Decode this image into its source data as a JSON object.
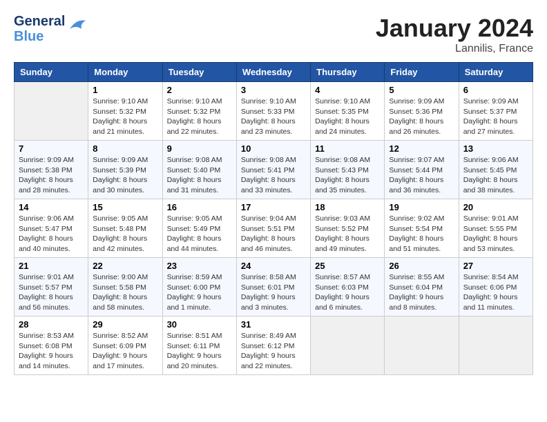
{
  "header": {
    "logo_general": "General",
    "logo_blue": "Blue",
    "month": "January 2024",
    "location": "Lannilis, France"
  },
  "weekdays": [
    "Sunday",
    "Monday",
    "Tuesday",
    "Wednesday",
    "Thursday",
    "Friday",
    "Saturday"
  ],
  "weeks": [
    [
      {
        "day": "",
        "info": ""
      },
      {
        "day": "1",
        "info": "Sunrise: 9:10 AM\nSunset: 5:32 PM\nDaylight: 8 hours\nand 21 minutes."
      },
      {
        "day": "2",
        "info": "Sunrise: 9:10 AM\nSunset: 5:32 PM\nDaylight: 8 hours\nand 22 minutes."
      },
      {
        "day": "3",
        "info": "Sunrise: 9:10 AM\nSunset: 5:33 PM\nDaylight: 8 hours\nand 23 minutes."
      },
      {
        "day": "4",
        "info": "Sunrise: 9:10 AM\nSunset: 5:35 PM\nDaylight: 8 hours\nand 24 minutes."
      },
      {
        "day": "5",
        "info": "Sunrise: 9:09 AM\nSunset: 5:36 PM\nDaylight: 8 hours\nand 26 minutes."
      },
      {
        "day": "6",
        "info": "Sunrise: 9:09 AM\nSunset: 5:37 PM\nDaylight: 8 hours\nand 27 minutes."
      }
    ],
    [
      {
        "day": "7",
        "info": "Sunrise: 9:09 AM\nSunset: 5:38 PM\nDaylight: 8 hours\nand 28 minutes."
      },
      {
        "day": "8",
        "info": "Sunrise: 9:09 AM\nSunset: 5:39 PM\nDaylight: 8 hours\nand 30 minutes."
      },
      {
        "day": "9",
        "info": "Sunrise: 9:08 AM\nSunset: 5:40 PM\nDaylight: 8 hours\nand 31 minutes."
      },
      {
        "day": "10",
        "info": "Sunrise: 9:08 AM\nSunset: 5:41 PM\nDaylight: 8 hours\nand 33 minutes."
      },
      {
        "day": "11",
        "info": "Sunrise: 9:08 AM\nSunset: 5:43 PM\nDaylight: 8 hours\nand 35 minutes."
      },
      {
        "day": "12",
        "info": "Sunrise: 9:07 AM\nSunset: 5:44 PM\nDaylight: 8 hours\nand 36 minutes."
      },
      {
        "day": "13",
        "info": "Sunrise: 9:06 AM\nSunset: 5:45 PM\nDaylight: 8 hours\nand 38 minutes."
      }
    ],
    [
      {
        "day": "14",
        "info": "Sunrise: 9:06 AM\nSunset: 5:47 PM\nDaylight: 8 hours\nand 40 minutes."
      },
      {
        "day": "15",
        "info": "Sunrise: 9:05 AM\nSunset: 5:48 PM\nDaylight: 8 hours\nand 42 minutes."
      },
      {
        "day": "16",
        "info": "Sunrise: 9:05 AM\nSunset: 5:49 PM\nDaylight: 8 hours\nand 44 minutes."
      },
      {
        "day": "17",
        "info": "Sunrise: 9:04 AM\nSunset: 5:51 PM\nDaylight: 8 hours\nand 46 minutes."
      },
      {
        "day": "18",
        "info": "Sunrise: 9:03 AM\nSunset: 5:52 PM\nDaylight: 8 hours\nand 49 minutes."
      },
      {
        "day": "19",
        "info": "Sunrise: 9:02 AM\nSunset: 5:54 PM\nDaylight: 8 hours\nand 51 minutes."
      },
      {
        "day": "20",
        "info": "Sunrise: 9:01 AM\nSunset: 5:55 PM\nDaylight: 8 hours\nand 53 minutes."
      }
    ],
    [
      {
        "day": "21",
        "info": "Sunrise: 9:01 AM\nSunset: 5:57 PM\nDaylight: 8 hours\nand 56 minutes."
      },
      {
        "day": "22",
        "info": "Sunrise: 9:00 AM\nSunset: 5:58 PM\nDaylight: 8 hours\nand 58 minutes."
      },
      {
        "day": "23",
        "info": "Sunrise: 8:59 AM\nSunset: 6:00 PM\nDaylight: 9 hours\nand 1 minute."
      },
      {
        "day": "24",
        "info": "Sunrise: 8:58 AM\nSunset: 6:01 PM\nDaylight: 9 hours\nand 3 minutes."
      },
      {
        "day": "25",
        "info": "Sunrise: 8:57 AM\nSunset: 6:03 PM\nDaylight: 9 hours\nand 6 minutes."
      },
      {
        "day": "26",
        "info": "Sunrise: 8:55 AM\nSunset: 6:04 PM\nDaylight: 9 hours\nand 8 minutes."
      },
      {
        "day": "27",
        "info": "Sunrise: 8:54 AM\nSunset: 6:06 PM\nDaylight: 9 hours\nand 11 minutes."
      }
    ],
    [
      {
        "day": "28",
        "info": "Sunrise: 8:53 AM\nSunset: 6:08 PM\nDaylight: 9 hours\nand 14 minutes."
      },
      {
        "day": "29",
        "info": "Sunrise: 8:52 AM\nSunset: 6:09 PM\nDaylight: 9 hours\nand 17 minutes."
      },
      {
        "day": "30",
        "info": "Sunrise: 8:51 AM\nSunset: 6:11 PM\nDaylight: 9 hours\nand 20 minutes."
      },
      {
        "day": "31",
        "info": "Sunrise: 8:49 AM\nSunset: 6:12 PM\nDaylight: 9 hours\nand 22 minutes."
      },
      {
        "day": "",
        "info": ""
      },
      {
        "day": "",
        "info": ""
      },
      {
        "day": "",
        "info": ""
      }
    ]
  ]
}
